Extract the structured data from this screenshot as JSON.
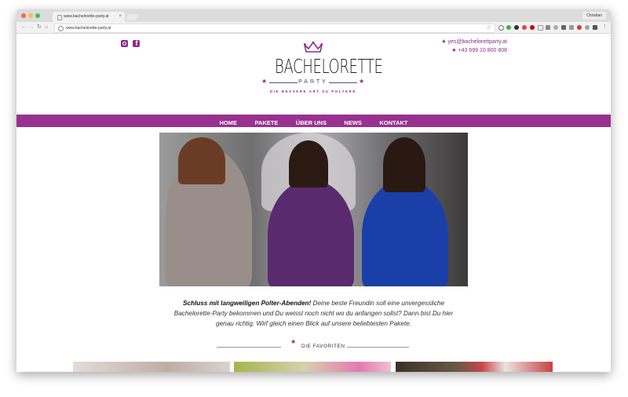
{
  "browser": {
    "tab_title": "www.bachelorette-party.at",
    "tab_close": "×",
    "profile": "Christian",
    "url": "www.bachelorette-party.at"
  },
  "header": {
    "email": "yes@bachelorettparty.at",
    "phone": "+43 699 10 800 808",
    "brand": "BACHELORETTE",
    "sub": "PARTY",
    "tagline": "DIE BESSERE ART ZU POLTERN"
  },
  "menu": {
    "items": [
      "HOME",
      "PAKETE",
      "ÜBER UNS",
      "NEWS",
      "KONTAKT"
    ]
  },
  "intro": {
    "bold": "Schluss mit langweiligen Polter-Abenden!",
    "text": " Deine beste Freundin soll eine unvergessliche Bachelorette-Party bekommen und Du weisst noch nicht wo du anfangen sollst? Dann bist Du hier genau richtig. Wirf gleich einen Blick auf unsere beliebtesten Pakete."
  },
  "favorites": {
    "heading": "DIE FAVORITEN"
  },
  "colors": {
    "brand": "#98318f",
    "accent": "#8e2a8a"
  },
  "icons": [
    "instagram-icon",
    "facebook-icon",
    "crown-icon",
    "star-icon"
  ]
}
